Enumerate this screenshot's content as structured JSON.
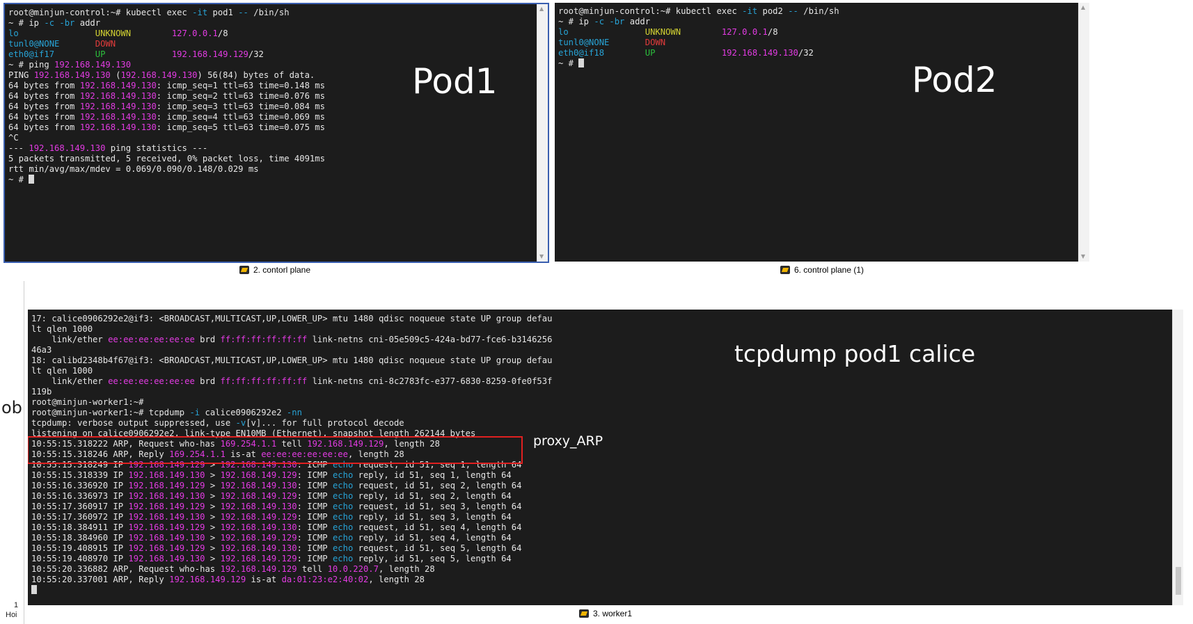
{
  "panes": {
    "pod1": {
      "caption": "2. contorl plane",
      "overlay_label": "Pod1",
      "lines": [
        [
          {
            "t": "root@minjun-control:~# kubectl exec ",
            "c": "w"
          },
          {
            "t": "-it",
            "c": "c"
          },
          {
            "t": " pod1 ",
            "c": "w"
          },
          {
            "t": "--",
            "c": "c"
          },
          {
            "t": " /bin/sh",
            "c": "w"
          }
        ],
        [
          {
            "t": "~ # ip ",
            "c": "w"
          },
          {
            "t": "-c -br",
            "c": "c"
          },
          {
            "t": " addr",
            "c": "w"
          }
        ],
        [
          {
            "t": "lo               ",
            "c": "c"
          },
          {
            "t": "UNKNOWN        ",
            "c": "y"
          },
          {
            "t": "127.0.0.1",
            "c": "m"
          },
          {
            "t": "/8",
            "c": "w"
          }
        ],
        [
          {
            "t": "tunl0@NONE       ",
            "c": "c"
          },
          {
            "t": "DOWN",
            "c": "r"
          }
        ],
        [
          {
            "t": "eth0@if17        ",
            "c": "c"
          },
          {
            "t": "UP             ",
            "c": "g"
          },
          {
            "t": "192.168.149.129",
            "c": "m"
          },
          {
            "t": "/32",
            "c": "w"
          }
        ],
        [
          {
            "t": "~ # ping ",
            "c": "w"
          },
          {
            "t": "192.168.149.130",
            "c": "m"
          }
        ],
        [
          {
            "t": "PING ",
            "c": "w"
          },
          {
            "t": "192.168.149.130",
            "c": "m"
          },
          {
            "t": " (",
            "c": "w"
          },
          {
            "t": "192.168.149.130",
            "c": "m"
          },
          {
            "t": ") 56(84) bytes of data.",
            "c": "w"
          }
        ],
        [
          {
            "t": "64 bytes from ",
            "c": "w"
          },
          {
            "t": "192.168.149.130",
            "c": "m"
          },
          {
            "t": ": icmp_seq=1 ttl=63 time=0.148 ms",
            "c": "w"
          }
        ],
        [
          {
            "t": "64 bytes from ",
            "c": "w"
          },
          {
            "t": "192.168.149.130",
            "c": "m"
          },
          {
            "t": ": icmp_seq=2 ttl=63 time=0.076 ms",
            "c": "w"
          }
        ],
        [
          {
            "t": "64 bytes from ",
            "c": "w"
          },
          {
            "t": "192.168.149.130",
            "c": "m"
          },
          {
            "t": ": icmp_seq=3 ttl=63 time=0.084 ms",
            "c": "w"
          }
        ],
        [
          {
            "t": "64 bytes from ",
            "c": "w"
          },
          {
            "t": "192.168.149.130",
            "c": "m"
          },
          {
            "t": ": icmp_seq=4 ttl=63 time=0.069 ms",
            "c": "w"
          }
        ],
        [
          {
            "t": "64 bytes from ",
            "c": "w"
          },
          {
            "t": "192.168.149.130",
            "c": "m"
          },
          {
            "t": ": icmp_seq=5 ttl=63 time=0.075 ms",
            "c": "w"
          }
        ],
        [
          {
            "t": "^C",
            "c": "w"
          }
        ],
        [
          {
            "t": "--- ",
            "c": "w"
          },
          {
            "t": "192.168.149.130",
            "c": "m"
          },
          {
            "t": " ping statistics ---",
            "c": "w"
          }
        ],
        [
          {
            "t": "5 packets transmitted, 5 received, 0% packet loss, time 4091ms",
            "c": "w"
          }
        ],
        [
          {
            "t": "rtt min/avg/max/mdev = 0.069/0.090/0.148/0.029 ms",
            "c": "w"
          }
        ],
        [
          {
            "t": "~ # ",
            "c": "w"
          },
          {
            "cursor": true
          }
        ]
      ]
    },
    "pod2": {
      "caption": "6. control plane (1)",
      "overlay_label": "Pod2",
      "lines": [
        [
          {
            "t": "root@minjun-control:~# kubectl exec ",
            "c": "w"
          },
          {
            "t": "-it",
            "c": "c"
          },
          {
            "t": " pod2 ",
            "c": "w"
          },
          {
            "t": "--",
            "c": "c"
          },
          {
            "t": " /bin/sh",
            "c": "w"
          }
        ],
        [
          {
            "t": "~ # ip ",
            "c": "w"
          },
          {
            "t": "-c -br",
            "c": "c"
          },
          {
            "t": " addr",
            "c": "w"
          }
        ],
        [
          {
            "t": "lo               ",
            "c": "c"
          },
          {
            "t": "UNKNOWN        ",
            "c": "y"
          },
          {
            "t": "127.0.0.1",
            "c": "m"
          },
          {
            "t": "/8",
            "c": "w"
          }
        ],
        [
          {
            "t": "tunl0@NONE       ",
            "c": "c"
          },
          {
            "t": "DOWN",
            "c": "r"
          }
        ],
        [
          {
            "t": "eth0@if18        ",
            "c": "c"
          },
          {
            "t": "UP             ",
            "c": "g"
          },
          {
            "t": "192.168.149.130",
            "c": "m"
          },
          {
            "t": "/32",
            "c": "w"
          }
        ],
        [
          {
            "t": "~ # ",
            "c": "w"
          },
          {
            "cursor": true
          }
        ]
      ]
    },
    "worker1": {
      "caption": "3. worker1",
      "overlay_label": "tcpdump pod1 calice",
      "annotation": "proxy_ARP",
      "left_fragment": "ob",
      "left_bottom_1": "1",
      "left_bottom_2": "Hoi",
      "lines": [
        [
          {
            "t": "17: calice0906292e2@if3: <BROADCAST,MULTICAST,UP,LOWER_UP> mtu 1480 qdisc noqueue state UP group defau",
            "c": "w"
          }
        ],
        [
          {
            "t": "lt qlen 1000",
            "c": "w"
          }
        ],
        [
          {
            "t": "    link/ether ",
            "c": "w"
          },
          {
            "t": "ee:ee:ee:ee:ee:ee",
            "c": "m"
          },
          {
            "t": " brd ",
            "c": "w"
          },
          {
            "t": "ff:ff:ff:ff:ff:ff",
            "c": "m"
          },
          {
            "t": " link-netns cni-05e509c5-424a-bd77-fce6-b3146256",
            "c": "w"
          }
        ],
        [
          {
            "t": "46a3",
            "c": "w"
          }
        ],
        [
          {
            "t": "18: calibd2348b4f67@if3: <BROADCAST,MULTICAST,UP,LOWER_UP> mtu 1480 qdisc noqueue state UP group defau",
            "c": "w"
          }
        ],
        [
          {
            "t": "lt qlen 1000",
            "c": "w"
          }
        ],
        [
          {
            "t": "    link/ether ",
            "c": "w"
          },
          {
            "t": "ee:ee:ee:ee:ee:ee",
            "c": "m"
          },
          {
            "t": " brd ",
            "c": "w"
          },
          {
            "t": "ff:ff:ff:ff:ff:ff",
            "c": "m"
          },
          {
            "t": " link-netns cni-8c2783fc-e377-6830-8259-0fe0f53f",
            "c": "w"
          }
        ],
        [
          {
            "t": "119b",
            "c": "w"
          }
        ],
        [
          {
            "t": "root@minjun-worker1:~#",
            "c": "w"
          }
        ],
        [
          {
            "t": "root@minjun-worker1:~# tcpdump ",
            "c": "w"
          },
          {
            "t": "-i",
            "c": "c"
          },
          {
            "t": " calice0906292e2 ",
            "c": "w"
          },
          {
            "t": "-nn",
            "c": "c"
          }
        ],
        [
          {
            "t": "tcpdump: verbose output suppressed, use ",
            "c": "w"
          },
          {
            "t": "-v",
            "c": "c"
          },
          {
            "t": "[v]... for full protocol decode",
            "c": "w"
          }
        ],
        [
          {
            "t": "listening on calice0906292e2, link-type EN10MB (Ethernet), snapshot length 262144 bytes",
            "c": "w"
          }
        ],
        [
          {
            "t": "10:55:15.318222 ARP, Request who-has ",
            "c": "w"
          },
          {
            "t": "169.254.1.1",
            "c": "m"
          },
          {
            "t": " tell ",
            "c": "w"
          },
          {
            "t": "192.168.149.129",
            "c": "m"
          },
          {
            "t": ", length 28",
            "c": "w"
          }
        ],
        [
          {
            "t": "10:55:15.318246 ARP, Reply ",
            "c": "w"
          },
          {
            "t": "169.254.1.1",
            "c": "m"
          },
          {
            "t": " is-at ",
            "c": "w"
          },
          {
            "t": "ee:ee:ee:ee:ee:ee",
            "c": "m"
          },
          {
            "t": ", length 28",
            "c": "w"
          }
        ],
        [
          {
            "t": "10:55:15.318249 IP ",
            "c": "w"
          },
          {
            "t": "192.168.149.129",
            "c": "m"
          },
          {
            "t": " > ",
            "c": "w"
          },
          {
            "t": "192.168.149.130",
            "c": "m"
          },
          {
            "t": ": ICMP ",
            "c": "w"
          },
          {
            "t": "echo",
            "c": "c"
          },
          {
            "t": " request, id 51, seq 1, length 64",
            "c": "w"
          }
        ],
        [
          {
            "t": "10:55:15.318339 IP ",
            "c": "w"
          },
          {
            "t": "192.168.149.130",
            "c": "m"
          },
          {
            "t": " > ",
            "c": "w"
          },
          {
            "t": "192.168.149.129",
            "c": "m"
          },
          {
            "t": ": ICMP ",
            "c": "w"
          },
          {
            "t": "echo",
            "c": "c"
          },
          {
            "t": " reply, id 51, seq 1, length 64",
            "c": "w"
          }
        ],
        [
          {
            "t": "10:55:16.336920 IP ",
            "c": "w"
          },
          {
            "t": "192.168.149.129",
            "c": "m"
          },
          {
            "t": " > ",
            "c": "w"
          },
          {
            "t": "192.168.149.130",
            "c": "m"
          },
          {
            "t": ": ICMP ",
            "c": "w"
          },
          {
            "t": "echo",
            "c": "c"
          },
          {
            "t": " request, id 51, seq 2, length 64",
            "c": "w"
          }
        ],
        [
          {
            "t": "10:55:16.336973 IP ",
            "c": "w"
          },
          {
            "t": "192.168.149.130",
            "c": "m"
          },
          {
            "t": " > ",
            "c": "w"
          },
          {
            "t": "192.168.149.129",
            "c": "m"
          },
          {
            "t": ": ICMP ",
            "c": "w"
          },
          {
            "t": "echo",
            "c": "c"
          },
          {
            "t": " reply, id 51, seq 2, length 64",
            "c": "w"
          }
        ],
        [
          {
            "t": "10:55:17.360917 IP ",
            "c": "w"
          },
          {
            "t": "192.168.149.129",
            "c": "m"
          },
          {
            "t": " > ",
            "c": "w"
          },
          {
            "t": "192.168.149.130",
            "c": "m"
          },
          {
            "t": ": ICMP ",
            "c": "w"
          },
          {
            "t": "echo",
            "c": "c"
          },
          {
            "t": " request, id 51, seq 3, length 64",
            "c": "w"
          }
        ],
        [
          {
            "t": "10:55:17.360972 IP ",
            "c": "w"
          },
          {
            "t": "192.168.149.130",
            "c": "m"
          },
          {
            "t": " > ",
            "c": "w"
          },
          {
            "t": "192.168.149.129",
            "c": "m"
          },
          {
            "t": ": ICMP ",
            "c": "w"
          },
          {
            "t": "echo",
            "c": "c"
          },
          {
            "t": " reply, id 51, seq 3, length 64",
            "c": "w"
          }
        ],
        [
          {
            "t": "10:55:18.384911 IP ",
            "c": "w"
          },
          {
            "t": "192.168.149.129",
            "c": "m"
          },
          {
            "t": " > ",
            "c": "w"
          },
          {
            "t": "192.168.149.130",
            "c": "m"
          },
          {
            "t": ": ICMP ",
            "c": "w"
          },
          {
            "t": "echo",
            "c": "c"
          },
          {
            "t": " request, id 51, seq 4, length 64",
            "c": "w"
          }
        ],
        [
          {
            "t": "10:55:18.384960 IP ",
            "c": "w"
          },
          {
            "t": "192.168.149.130",
            "c": "m"
          },
          {
            "t": " > ",
            "c": "w"
          },
          {
            "t": "192.168.149.129",
            "c": "m"
          },
          {
            "t": ": ICMP ",
            "c": "w"
          },
          {
            "t": "echo",
            "c": "c"
          },
          {
            "t": " reply, id 51, seq 4, length 64",
            "c": "w"
          }
        ],
        [
          {
            "t": "10:55:19.408915 IP ",
            "c": "w"
          },
          {
            "t": "192.168.149.129",
            "c": "m"
          },
          {
            "t": " > ",
            "c": "w"
          },
          {
            "t": "192.168.149.130",
            "c": "m"
          },
          {
            "t": ": ICMP ",
            "c": "w"
          },
          {
            "t": "echo",
            "c": "c"
          },
          {
            "t": " request, id 51, seq 5, length 64",
            "c": "w"
          }
        ],
        [
          {
            "t": "10:55:19.408970 IP ",
            "c": "w"
          },
          {
            "t": "192.168.149.130",
            "c": "m"
          },
          {
            "t": " > ",
            "c": "w"
          },
          {
            "t": "192.168.149.129",
            "c": "m"
          },
          {
            "t": ": ICMP ",
            "c": "w"
          },
          {
            "t": "echo",
            "c": "c"
          },
          {
            "t": " reply, id 51, seq 5, length 64",
            "c": "w"
          }
        ],
        [
          {
            "t": "10:55:20.336882 ARP, Request who-has ",
            "c": "w"
          },
          {
            "t": "192.168.149.129",
            "c": "m"
          },
          {
            "t": " tell ",
            "c": "w"
          },
          {
            "t": "10.0.220.7",
            "c": "m"
          },
          {
            "t": ", length 28",
            "c": "w"
          }
        ],
        [
          {
            "t": "10:55:20.337001 ARP, Reply ",
            "c": "w"
          },
          {
            "t": "192.168.149.129",
            "c": "m"
          },
          {
            "t": " is-at ",
            "c": "w"
          },
          {
            "t": "da:01:23:e2:40:02",
            "c": "m"
          },
          {
            "t": ", length 28",
            "c": "w"
          }
        ],
        [
          {
            "cursor": true
          }
        ]
      ]
    }
  },
  "colors": {
    "terminal_bg": "#1c1c1c",
    "default_text": "#e6e6e6",
    "magenta": "#e23be2",
    "cyan": "#27a3d6",
    "green": "#2bbf3c",
    "yellow": "#d2d232",
    "red": "#e23b3b",
    "highlight_box": "#e02020",
    "active_border": "#3a5fb0"
  },
  "icons": {
    "caption_icon": "terminal-tab-icon",
    "scroll_up": "scroll-up-arrow-icon",
    "scroll_down": "scroll-down-arrow-icon"
  }
}
